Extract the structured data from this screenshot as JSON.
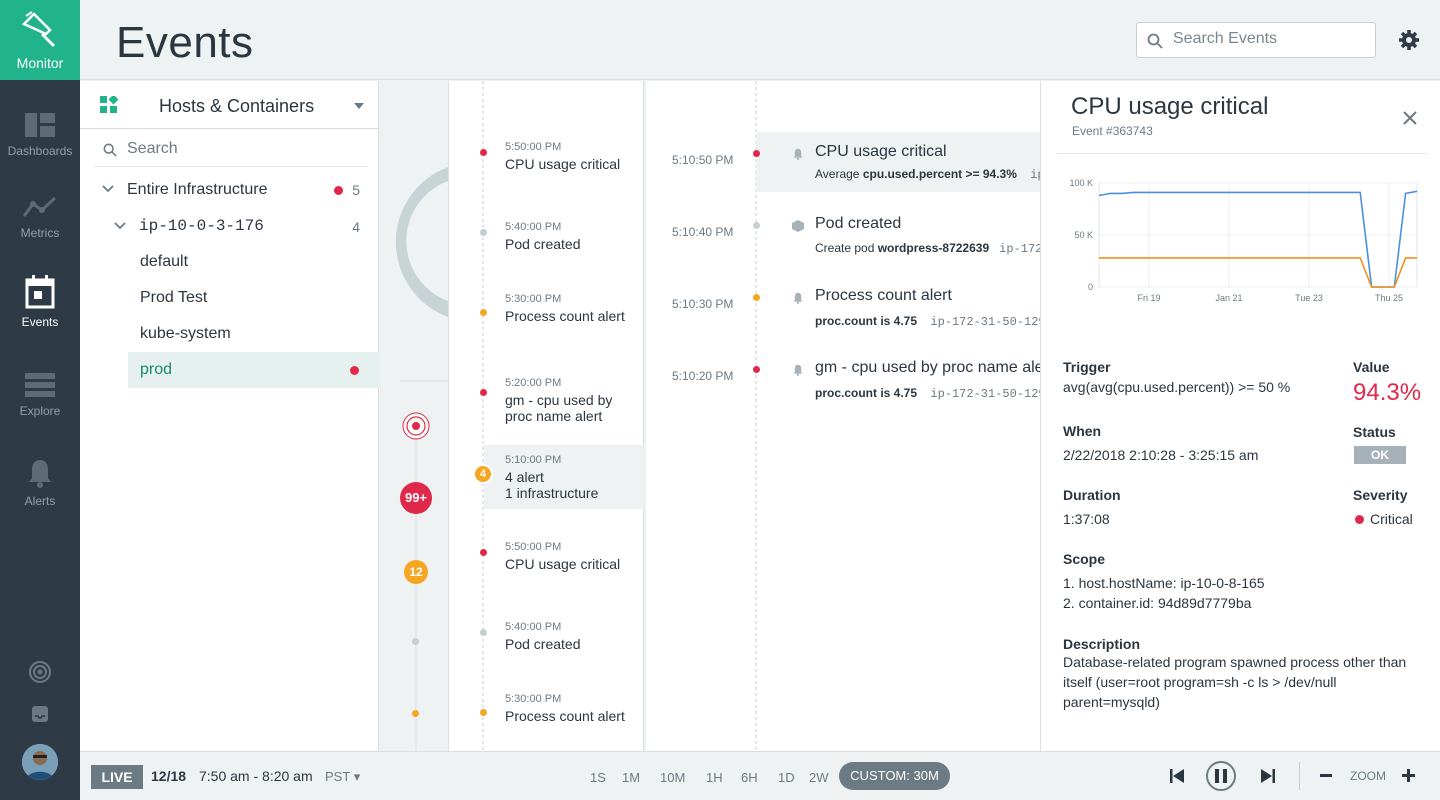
{
  "nav": {
    "brand": "Monitor",
    "items": [
      {
        "label": "Dashboards"
      },
      {
        "label": "Metrics"
      },
      {
        "label": "Events"
      },
      {
        "label": "Explore"
      },
      {
        "label": "Alerts"
      }
    ]
  },
  "header": {
    "title": "Events",
    "search_placeholder": "Search Events"
  },
  "tree": {
    "scope_title": "Hosts & Containers",
    "search_placeholder": "Search",
    "root": {
      "label": "Entire Infrastructure",
      "count": "5"
    },
    "host": {
      "label": "ip-10-0-3-176",
      "count": "4"
    },
    "children": [
      "default",
      "Prod Test",
      "kube-system",
      "prod"
    ]
  },
  "timeline": {
    "badge1": "99+",
    "badge2": "12"
  },
  "list1": [
    {
      "time": "5:50:00 PM",
      "name": "CPU usage critical"
    },
    {
      "time": "5:40:00 PM",
      "name": "Pod created"
    },
    {
      "time": "5:30:00 PM",
      "name": "Process count alert"
    },
    {
      "time": "5:20:00 PM",
      "name": "gm - cpu used by proc name alert"
    },
    {
      "time": "5:10:00 PM",
      "name": "4 alert",
      "name2": "1 infrastructure",
      "badge": "4"
    },
    {
      "time": "5:50:00 PM",
      "name": "CPU usage critical"
    },
    {
      "time": "5:40:00 PM",
      "name": "Pod created"
    },
    {
      "time": "5:30:00 PM",
      "name": "Process count alert"
    }
  ],
  "events": [
    {
      "time": "5:10:50 PM",
      "title": "CPU usage critical",
      "sub_pre": "Average ",
      "sub_bold": "cpu.used.percent",
      "sub_post": " >= 94.3%",
      "sub_mono": "ip"
    },
    {
      "time": "5:10:40 PM",
      "title": "Pod created",
      "sub_pre": "Create pod ",
      "sub_bold": "wordpress-8722639",
      "sub_post": "",
      "sub_mono": "ip-172"
    },
    {
      "time": "5:10:30 PM",
      "title": "Process count alert",
      "sub_pre": "",
      "sub_bold": "proc.count",
      "sub_post": " is 4.75",
      "sub_mono": "ip-172-31-50-129"
    },
    {
      "time": "5:10:20 PM",
      "title": "gm - cpu used by proc name ale",
      "sub_pre": "",
      "sub_bold": "proc.count",
      "sub_post": " is 4.75",
      "sub_mono": "ip-172-31-50-129"
    }
  ],
  "detail": {
    "title": "CPU usage critical",
    "event_id": "Event #363743",
    "trigger_label": "Trigger",
    "trigger": "avg(avg(cpu.used.percent)) >= 50 %",
    "value_label": "Value",
    "value": "94.3%",
    "when_label": "When",
    "when": "2/22/2018 2:10:28 - 3:25:15 am",
    "status_label": "Status",
    "status": "OK",
    "duration_label": "Duration",
    "duration": "1:37:08",
    "severity_label": "Severity",
    "severity": "Critical",
    "scope_label": "Scope",
    "scope1": "1. host.hostName: ip-10-0-8-165",
    "scope2": "2. container.id: 94d89d7779ba",
    "desc_label": "Description",
    "desc": "Database-related program spawned process other than itself (user=root program=sh -c ls > /dev/null parent=mysqld)"
  },
  "chart_data": {
    "type": "line",
    "ylabels": [
      "100 K",
      "50 K",
      "0"
    ],
    "xlabels": [
      "Fri 19",
      "Jan 21",
      "Tue 23",
      "Thu 25"
    ],
    "series": [
      {
        "color": "#4a90e2",
        "values": [
          88,
          90,
          90,
          91,
          91,
          91,
          91,
          91,
          91,
          91,
          91,
          91,
          91,
          91,
          91,
          91,
          91,
          91,
          91,
          91,
          91,
          91,
          91,
          91,
          0,
          0,
          0,
          90,
          92
        ]
      },
      {
        "color": "#f0901e",
        "values": [
          28,
          28,
          28,
          28,
          28,
          28,
          28,
          28,
          28,
          28,
          28,
          28,
          28,
          28,
          28,
          28,
          28,
          28,
          28,
          28,
          28,
          28,
          28,
          28,
          0,
          0,
          0,
          28,
          28
        ]
      }
    ]
  },
  "footer": {
    "live": "LIVE",
    "date": "12/18",
    "time": "7:50 am - 8:20 am",
    "tz": "PST",
    "ranges": [
      "1S",
      "1M",
      "10M",
      "1H",
      "6H",
      "1D",
      "2W"
    ],
    "custom_label": "CUSTOM:",
    "custom_value": "30M",
    "zoom": "ZOOM"
  },
  "colors": {
    "accent": "#21b38a",
    "critical": "#e0294a",
    "warning": "#f5a623",
    "nav": "#2e3b46"
  }
}
